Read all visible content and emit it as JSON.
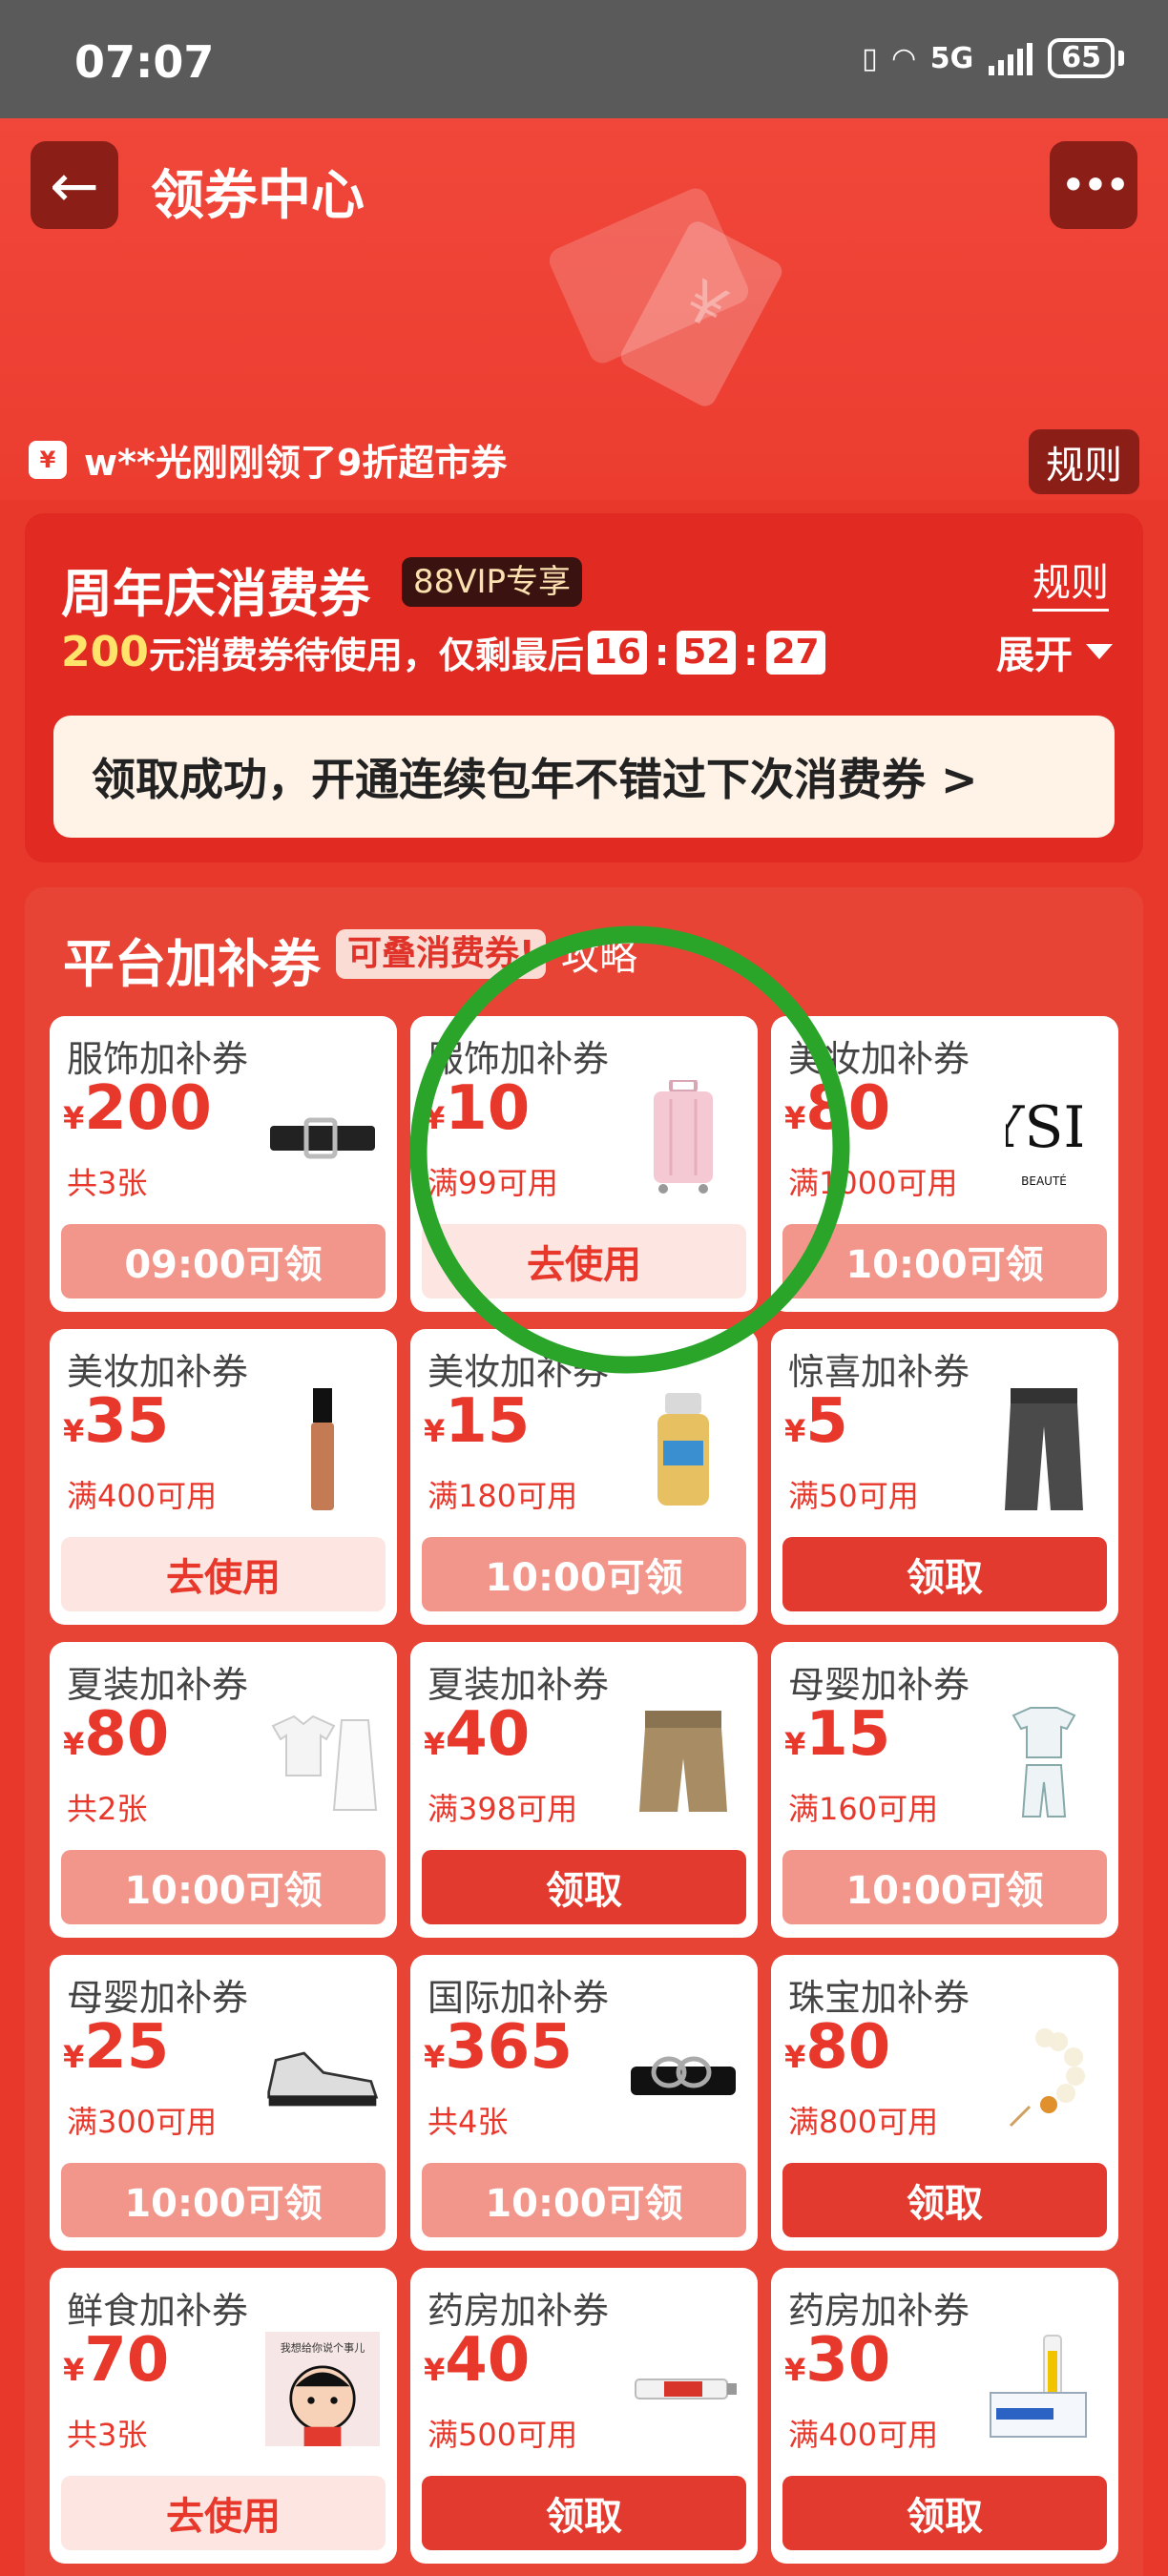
{
  "status_bar": {
    "time": "07:07",
    "network": "5G",
    "battery": "65"
  },
  "header": {
    "title": "领券中心",
    "ticker_text": "w**光刚刚领了9折超市券",
    "rules_label": "规则"
  },
  "anniversary": {
    "title": "周年庆消费券",
    "vip_badge": "88VIP专享",
    "rules_label": "规则",
    "amount": "200",
    "desc": "元消费券待使用，仅剩最后",
    "countdown": [
      "16",
      "52",
      "27"
    ],
    "expand_label": "展开",
    "success_text": "领取成功，开通连续包年不错过下次消费券 >"
  },
  "platform": {
    "title": "平台加补券",
    "badge": "可叠消费券!",
    "guide": "攻略",
    "coupons": [
      {
        "name": "服饰加补券",
        "yen": "¥",
        "amount": "200",
        "cond": "共3张",
        "button": "09:00可领",
        "state": "wait",
        "icon": "belt-icon"
      },
      {
        "name": "服饰加补券",
        "yen": "¥",
        "amount": "10",
        "cond": "满99可用",
        "button": "去使用",
        "state": "use",
        "icon": "suitcase-icon"
      },
      {
        "name": "美妆加补券",
        "yen": "¥",
        "amount": "80",
        "cond": "满1000可用",
        "button": "10:00可领",
        "state": "wait",
        "icon": "ysl-logo-icon"
      },
      {
        "name": "美妆加补券",
        "yen": "¥",
        "amount": "35",
        "cond": "满400可用",
        "button": "去使用",
        "state": "use",
        "icon": "lipgloss-icon"
      },
      {
        "name": "美妆加补券",
        "yen": "¥",
        "amount": "15",
        "cond": "满180可用",
        "button": "10:00可领",
        "state": "wait",
        "icon": "sunscreen-icon"
      },
      {
        "name": "惊喜加补券",
        "yen": "¥",
        "amount": "5",
        "cond": "满50可用",
        "button": "领取",
        "state": "get",
        "icon": "pants-icon"
      },
      {
        "name": "夏装加补券",
        "yen": "¥",
        "amount": "80",
        "cond": "共2张",
        "button": "10:00可领",
        "state": "wait",
        "icon": "blouse-skirt-icon"
      },
      {
        "name": "夏装加补券",
        "yen": "¥",
        "amount": "40",
        "cond": "满398可用",
        "button": "领取",
        "state": "get",
        "icon": "shorts-icon"
      },
      {
        "name": "母婴加补券",
        "yen": "¥",
        "amount": "15",
        "cond": "满160可用",
        "button": "10:00可领",
        "state": "wait",
        "icon": "baby-clothes-icon"
      },
      {
        "name": "母婴加补券",
        "yen": "¥",
        "amount": "25",
        "cond": "满300可用",
        "button": "10:00可领",
        "state": "wait",
        "icon": "sneaker-icon"
      },
      {
        "name": "国际加补券",
        "yen": "¥",
        "amount": "365",
        "cond": "共4张",
        "button": "10:00可领",
        "state": "wait",
        "icon": "luxury-belt-icon"
      },
      {
        "name": "珠宝加补券",
        "yen": "¥",
        "amount": "80",
        "cond": "满800可用",
        "button": "领取",
        "state": "get",
        "icon": "bracelet-icon"
      },
      {
        "name": "鲜食加补券",
        "yen": "¥",
        "amount": "70",
        "cond": "共3张",
        "button": "去使用",
        "state": "use",
        "icon": "cartoon-sticker-icon"
      },
      {
        "name": "药房加补券",
        "yen": "¥",
        "amount": "40",
        "cond": "满500可用",
        "button": "领取",
        "state": "get",
        "icon": "ointment-tube-icon"
      },
      {
        "name": "药房加补券",
        "yen": "¥",
        "amount": "30",
        "cond": "满400可用",
        "button": "领取",
        "state": "get",
        "icon": "medicine-box-icon"
      }
    ]
  },
  "colors": {
    "brand_red": "#e8382c",
    "annotation_green": "#2aa52a"
  }
}
